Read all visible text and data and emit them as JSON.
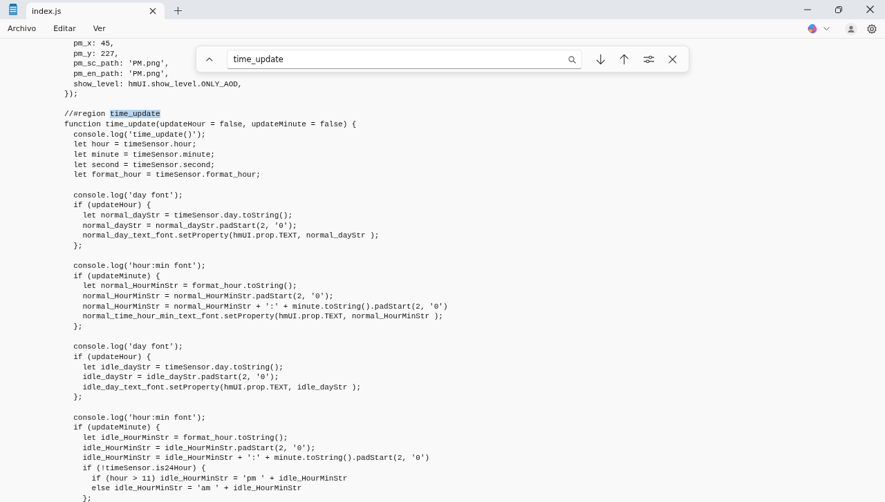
{
  "tabs": [
    {
      "label": "index.js",
      "selected": true
    }
  ],
  "menu": [
    "Archivo",
    "Editar",
    "Ver"
  ],
  "find": {
    "value": "time_update"
  },
  "code": [
    {
      "kind": "code",
      "text": "  pm_x: 45,"
    },
    {
      "kind": "code",
      "text": "  pm_y: 227,"
    },
    {
      "kind": "code",
      "text": "  pm_sc_path: 'PM.png',"
    },
    {
      "kind": "code",
      "text": "  pm_en_path: 'PM.png',"
    },
    {
      "kind": "code",
      "text": "  show_level: hmUI.show_level.ONLY_AOD,"
    },
    {
      "kind": "code",
      "text": "});"
    },
    {
      "kind": "blank"
    },
    {
      "kind": "code",
      "text": "//#region ",
      "highlight": "time_update"
    },
    {
      "kind": "code",
      "text": "function time_update(updateHour = false, updateMinute = false) {"
    },
    {
      "kind": "code",
      "text": "  console.log('time_update()');"
    },
    {
      "kind": "code",
      "text": "  let hour = timeSensor.hour;"
    },
    {
      "kind": "code",
      "text": "  let minute = timeSensor.minute;"
    },
    {
      "kind": "code",
      "text": "  let second = timeSensor.second;"
    },
    {
      "kind": "code",
      "text": "  let format_hour = timeSensor.format_hour;"
    },
    {
      "kind": "blank"
    },
    {
      "kind": "code",
      "text": "  console.log('day font');"
    },
    {
      "kind": "code",
      "text": "  if (updateHour) {"
    },
    {
      "kind": "code",
      "text": "    let normal_dayStr = timeSensor.day.toString();"
    },
    {
      "kind": "code",
      "text": "    normal_dayStr = normal_dayStr.padStart(2, '0');"
    },
    {
      "kind": "code",
      "text": "    normal_day_text_font.setProperty(hmUI.prop.TEXT, normal_dayStr );"
    },
    {
      "kind": "code",
      "text": "  };"
    },
    {
      "kind": "blank"
    },
    {
      "kind": "code",
      "text": "  console.log('hour:min font');"
    },
    {
      "kind": "code",
      "text": "  if (updateMinute) {"
    },
    {
      "kind": "code",
      "text": "    let normal_HourMinStr = format_hour.toString();"
    },
    {
      "kind": "code",
      "text": "    normal_HourMinStr = normal_HourMinStr.padStart(2, '0');"
    },
    {
      "kind": "code",
      "text": "    normal_HourMinStr = normal_HourMinStr + ':' + minute.toString().padStart(2, '0')"
    },
    {
      "kind": "code",
      "text": "    normal_time_hour_min_text_font.setProperty(hmUI.prop.TEXT, normal_HourMinStr );"
    },
    {
      "kind": "code",
      "text": "  };"
    },
    {
      "kind": "blank"
    },
    {
      "kind": "code",
      "text": "  console.log('day font');"
    },
    {
      "kind": "code",
      "text": "  if (updateHour) {"
    },
    {
      "kind": "code",
      "text": "    let idle_dayStr = timeSensor.day.toString();"
    },
    {
      "kind": "code",
      "text": "    idle_dayStr = idle_dayStr.padStart(2, '0');"
    },
    {
      "kind": "code",
      "text": "    idle_day_text_font.setProperty(hmUI.prop.TEXT, idle_dayStr );"
    },
    {
      "kind": "code",
      "text": "  };"
    },
    {
      "kind": "blank"
    },
    {
      "kind": "code",
      "text": "  console.log('hour:min font');"
    },
    {
      "kind": "code",
      "text": "  if (updateMinute) {"
    },
    {
      "kind": "code",
      "text": "    let idle_HourMinStr = format_hour.toString();"
    },
    {
      "kind": "code",
      "text": "    idle_HourMinStr = idle_HourMinStr.padStart(2, '0');"
    },
    {
      "kind": "code",
      "text": "    idle_HourMinStr = idle_HourMinStr + ':' + minute.toString().padStart(2, '0')"
    },
    {
      "kind": "code",
      "text": "    if (!timeSensor.is24Hour) {"
    },
    {
      "kind": "code",
      "text": "      if (hour > 11) idle_HourMinStr = 'pm ' + idle_HourMinStr"
    },
    {
      "kind": "code",
      "text": "      else idle_HourMinStr = 'am ' + idle_HourMinStr"
    },
    {
      "kind": "code",
      "text": "    };"
    }
  ]
}
